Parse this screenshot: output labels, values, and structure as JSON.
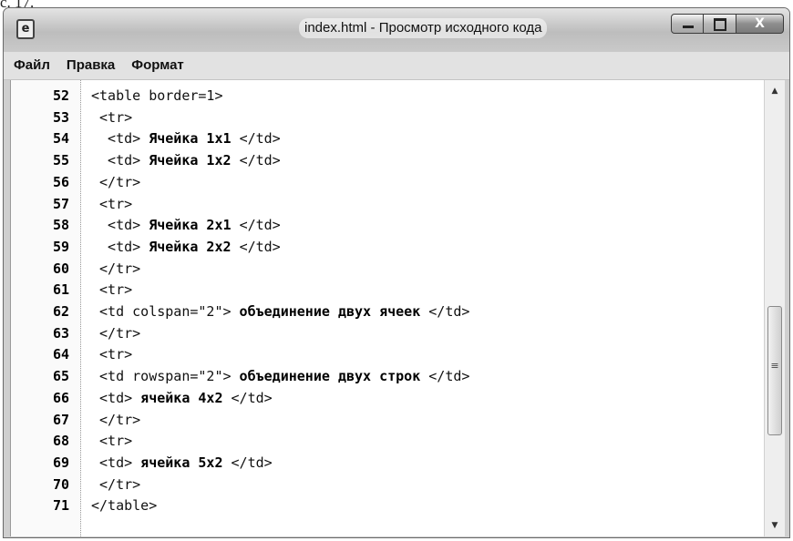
{
  "caption_fragment": "с. 17.",
  "window": {
    "title": "index.html - Просмотр исходного кода",
    "close_glyph": "X"
  },
  "menu": [
    {
      "label": "Файл"
    },
    {
      "label": "Правка"
    },
    {
      "label": "Формат"
    }
  ],
  "code": {
    "lines": [
      {
        "num": "52",
        "pre": "<table border=1>",
        "bold": "",
        "post": ""
      },
      {
        "num": "53",
        "pre": " <tr>",
        "bold": "",
        "post": ""
      },
      {
        "num": "54",
        "pre": "  <td>",
        "bold": " Ячейка 1x1 ",
        "post": "</td>"
      },
      {
        "num": "55",
        "pre": "  <td>",
        "bold": " Ячейка 1x2 ",
        "post": "</td>"
      },
      {
        "num": "56",
        "pre": " </tr>",
        "bold": "",
        "post": ""
      },
      {
        "num": "57",
        "pre": " <tr>",
        "bold": "",
        "post": ""
      },
      {
        "num": "58",
        "pre": "  <td>",
        "bold": " Ячейка 2x1 ",
        "post": "</td>"
      },
      {
        "num": "59",
        "pre": "  <td>",
        "bold": " Ячейка 2x2 ",
        "post": "</td>"
      },
      {
        "num": "60",
        "pre": " </tr>",
        "bold": "",
        "post": ""
      },
      {
        "num": "61",
        "pre": " <tr>",
        "bold": "",
        "post": ""
      },
      {
        "num": "62",
        "pre": " <td colspan=\"2\">",
        "bold": " объединение двух ячеек ",
        "post": "</td>"
      },
      {
        "num": "63",
        "pre": " </tr>",
        "bold": "",
        "post": ""
      },
      {
        "num": "64",
        "pre": " <tr>",
        "bold": "",
        "post": ""
      },
      {
        "num": "65",
        "pre": " <td rowspan=\"2\">",
        "bold": " объединение двух строк ",
        "post": "</td>"
      },
      {
        "num": "66",
        "pre": " <td>",
        "bold": " ячейка 4x2 ",
        "post": "</td>"
      },
      {
        "num": "67",
        "pre": " </tr>",
        "bold": "",
        "post": ""
      },
      {
        "num": "68",
        "pre": " <tr>",
        "bold": "",
        "post": ""
      },
      {
        "num": "69",
        "pre": " <td>",
        "bold": " ячейка 5x2 ",
        "post": "</td>"
      },
      {
        "num": "70",
        "pre": " </tr>",
        "bold": "",
        "post": ""
      },
      {
        "num": "71",
        "pre": "</table>",
        "bold": "",
        "post": ""
      }
    ]
  },
  "scrollbar": {
    "up_arrow": "▲",
    "down_arrow": "▼",
    "grip": "≡",
    "position_fraction": 0.72
  }
}
